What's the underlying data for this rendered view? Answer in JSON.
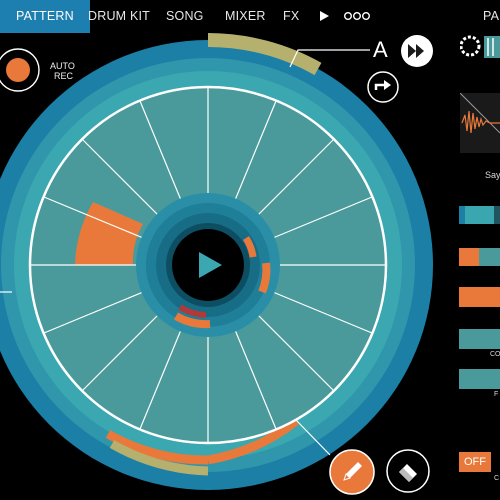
{
  "nav": {
    "tabs": [
      {
        "label": "PATTERN",
        "active": true
      },
      {
        "label": "DRUM KIT",
        "active": false
      },
      {
        "label": "SONG",
        "active": false
      },
      {
        "label": "MIXER",
        "active": false
      },
      {
        "label": "FX",
        "active": false
      }
    ],
    "play_icon": "play-icon",
    "more_icon": "more-dots-icon",
    "right_partial": "PA"
  },
  "recorder": {
    "auto_rec_label_line1": "AUTO",
    "auto_rec_label_line2": "REC",
    "record_icon": "record-icon"
  },
  "pattern": {
    "label": "A",
    "next_icon": "fast-forward-icon",
    "arrow_icon": "arrow-right-icon"
  },
  "tools": {
    "pencil_icon": "pencil-icon",
    "eraser_icon": "eraser-icon"
  },
  "side_panel": {
    "sample_name_partial": "Say",
    "label_co": "CO",
    "label_f": "F",
    "off_label": "OFF",
    "label_c": "C"
  },
  "colors": {
    "accent": "#1d7fb0",
    "teal": "#4a9a9c",
    "ring_outer": "#1b7fa6",
    "ring_inner": "#3aa6b0",
    "orange": "#e8793a",
    "olive": "#b6b06e",
    "active_step": "#e8793a"
  },
  "sequencer": {
    "steps": 16,
    "active_step_index": 5
  }
}
